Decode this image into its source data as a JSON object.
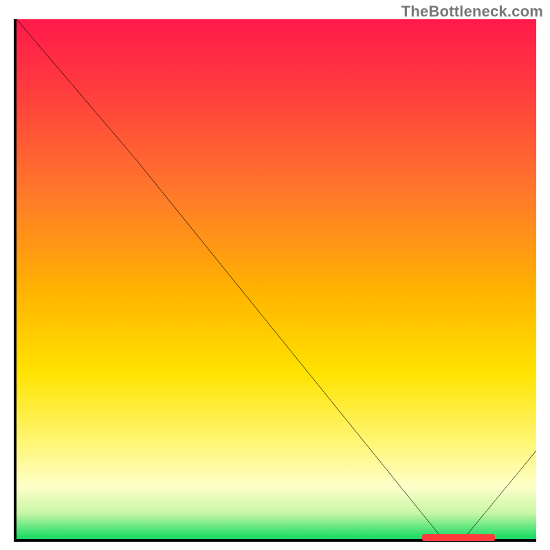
{
  "watermark": "TheBottleneck.com",
  "colors": {
    "axis": "#000000",
    "line": "#000000",
    "marker": "#ff3b3b",
    "watermark_text": "#777777",
    "gradient_top": "#ff1a4b",
    "gradient_mid": "#ffe300",
    "gradient_bottom": "#17d964"
  },
  "chart_data": {
    "type": "line",
    "title": "",
    "xlabel": "",
    "ylabel": "",
    "x": [
      0,
      23,
      82,
      86,
      100
    ],
    "values": [
      100,
      73,
      0,
      0,
      17
    ],
    "xlim": [
      0,
      100
    ],
    "ylim": [
      0,
      100
    ],
    "annotations": [
      {
        "kind": "marker-band",
        "x_start": 78,
        "x_end": 92,
        "y": 0
      }
    ]
  }
}
